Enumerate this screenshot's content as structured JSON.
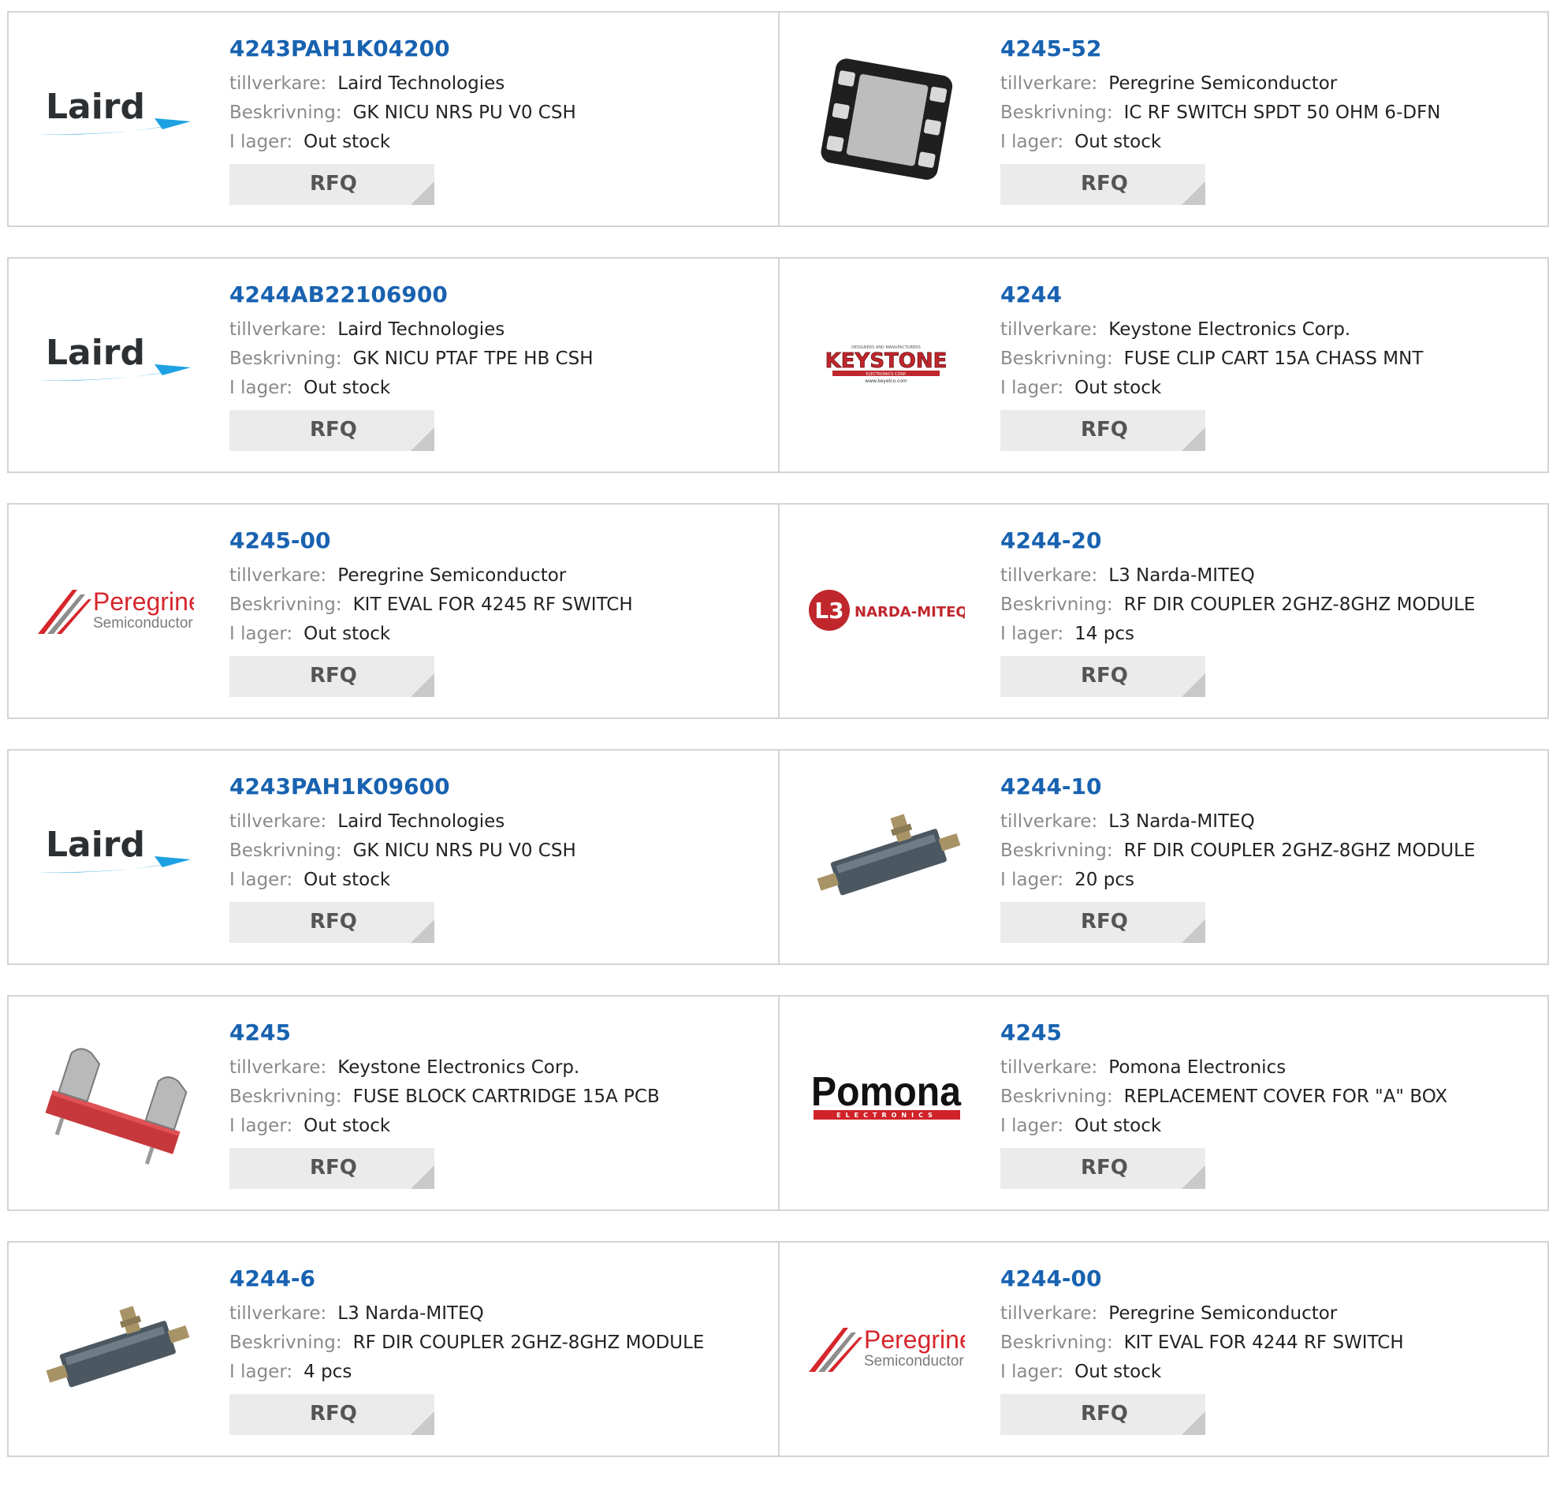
{
  "labels": {
    "manufacturer": "tillverkare:",
    "description": "Beskrivning:",
    "stock": "I lager:",
    "rfq": "RFQ"
  },
  "logos": {
    "laird": "Laird",
    "peregrine_name": "Peregrine",
    "peregrine_sub": "Semiconductor",
    "keystone": "KEYSTONE",
    "keystone_top": "DESIGNERS AND MANUFACTURERS",
    "keystone_mid": "ELECTRONICS CORP.",
    "keystone_url": "www.keyelco.com",
    "narda": "NARDA-MITEQ",
    "narda_l3": "L3",
    "pomona": "Pomona",
    "pomona_sub": "ELECTRONICS"
  },
  "products": [
    {
      "part": "4243PAH1K04200",
      "manufacturer": "Laird Technologies",
      "description": "GK NICU NRS PU V0 CSH",
      "stock": "Out stock",
      "image": "laird-logo"
    },
    {
      "part": "4245-52",
      "manufacturer": "Peregrine Semiconductor",
      "description": "IC RF SWITCH SPDT 50 OHM 6-DFN",
      "stock": "Out stock",
      "image": "dfn-chip"
    },
    {
      "part": "4244AB22106900",
      "manufacturer": "Laird Technologies",
      "description": "GK NICU PTAF TPE HB CSH",
      "stock": "Out stock",
      "image": "laird-logo"
    },
    {
      "part": "4244",
      "manufacturer": "Keystone Electronics Corp.",
      "description": "FUSE CLIP CART 15A CHASS MNT",
      "stock": "Out stock",
      "image": "keystone-logo"
    },
    {
      "part": "4245-00",
      "manufacturer": "Peregrine Semiconductor",
      "description": "KIT EVAL FOR 4245 RF SWITCH",
      "stock": "Out stock",
      "image": "peregrine-logo"
    },
    {
      "part": "4244-20",
      "manufacturer": "L3 Narda-MITEQ",
      "description": "RF DIR COUPLER 2GHZ-8GHZ MODULE",
      "stock": "14 pcs",
      "image": "narda-logo"
    },
    {
      "part": "4243PAH1K09600",
      "manufacturer": "Laird Technologies",
      "description": "GK NICU NRS PU V0 CSH",
      "stock": "Out stock",
      "image": "laird-logo"
    },
    {
      "part": "4244-10",
      "manufacturer": "L3 Narda-MITEQ",
      "description": "RF DIR COUPLER 2GHZ-8GHZ MODULE",
      "stock": "20 pcs",
      "image": "coupler-photo"
    },
    {
      "part": "4245",
      "manufacturer": "Keystone Electronics Corp.",
      "description": "FUSE BLOCK CARTRIDGE 15A PCB",
      "stock": "Out stock",
      "image": "fuse-block-photo"
    },
    {
      "part": "4245",
      "manufacturer": "Pomona Electronics",
      "description": "REPLACEMENT COVER FOR \"A\" BOX",
      "stock": "Out stock",
      "image": "pomona-logo"
    },
    {
      "part": "4244-6",
      "manufacturer": "L3 Narda-MITEQ",
      "description": "RF DIR COUPLER 2GHZ-8GHZ MODULE",
      "stock": "4 pcs",
      "image": "coupler-photo"
    },
    {
      "part": "4244-00",
      "manufacturer": "Peregrine Semiconductor",
      "description": "KIT EVAL FOR 4244 RF SWITCH",
      "stock": "Out stock",
      "image": "peregrine-logo"
    }
  ],
  "colors": {
    "part_link": "#1862b0",
    "label_gray": "#8a8a8a",
    "border": "#d4d4d4",
    "rfq_bg": "#ebebeb"
  }
}
